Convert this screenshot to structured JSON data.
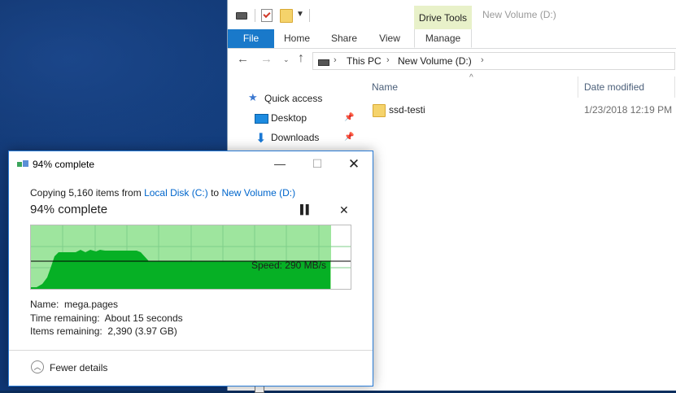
{
  "explorer": {
    "window_title": "New Volume (D:)",
    "contextual_tab_group": "Drive Tools",
    "tabs": [
      "File",
      "Home",
      "Share",
      "View",
      "Manage"
    ],
    "address": {
      "crumbs": [
        "This PC",
        "New Volume (D:)"
      ]
    },
    "nav_pane": {
      "items": [
        {
          "label": "Quick access",
          "icon": "star-icon"
        },
        {
          "label": "Desktop",
          "icon": "desktop-icon",
          "pinned": true
        },
        {
          "label": "Downloads",
          "icon": "downloads-icon",
          "pinned": true
        }
      ]
    },
    "columns": [
      "Name",
      "Date modified"
    ],
    "files": [
      {
        "name": "ssd-testi",
        "date_modified": "1/23/2018 12:19 PM",
        "icon": "folder-icon"
      }
    ]
  },
  "dialog": {
    "title": "94% complete",
    "copy_prefix": "Copying 5,160 items from ",
    "source": "Local Disk (C:)",
    "copy_mid": " to ",
    "destination": "New Volume (D:)",
    "progress_text": "94% complete",
    "progress_fraction": 0.94,
    "speed_label": "Speed: 290 MB/s",
    "name_row": "Name:  mega.pages",
    "time_row": "Time remaining:  About 15 seconds",
    "items_row": "Items remaining:  2,390 (3.97 GB)",
    "fewer_details": "Fewer details"
  },
  "colors": {
    "accent_blue": "#1979ca",
    "contextual_tab_bg": "#e8f1c9",
    "progress_light": "#9ee59e",
    "progress_dark": "#06b025"
  }
}
